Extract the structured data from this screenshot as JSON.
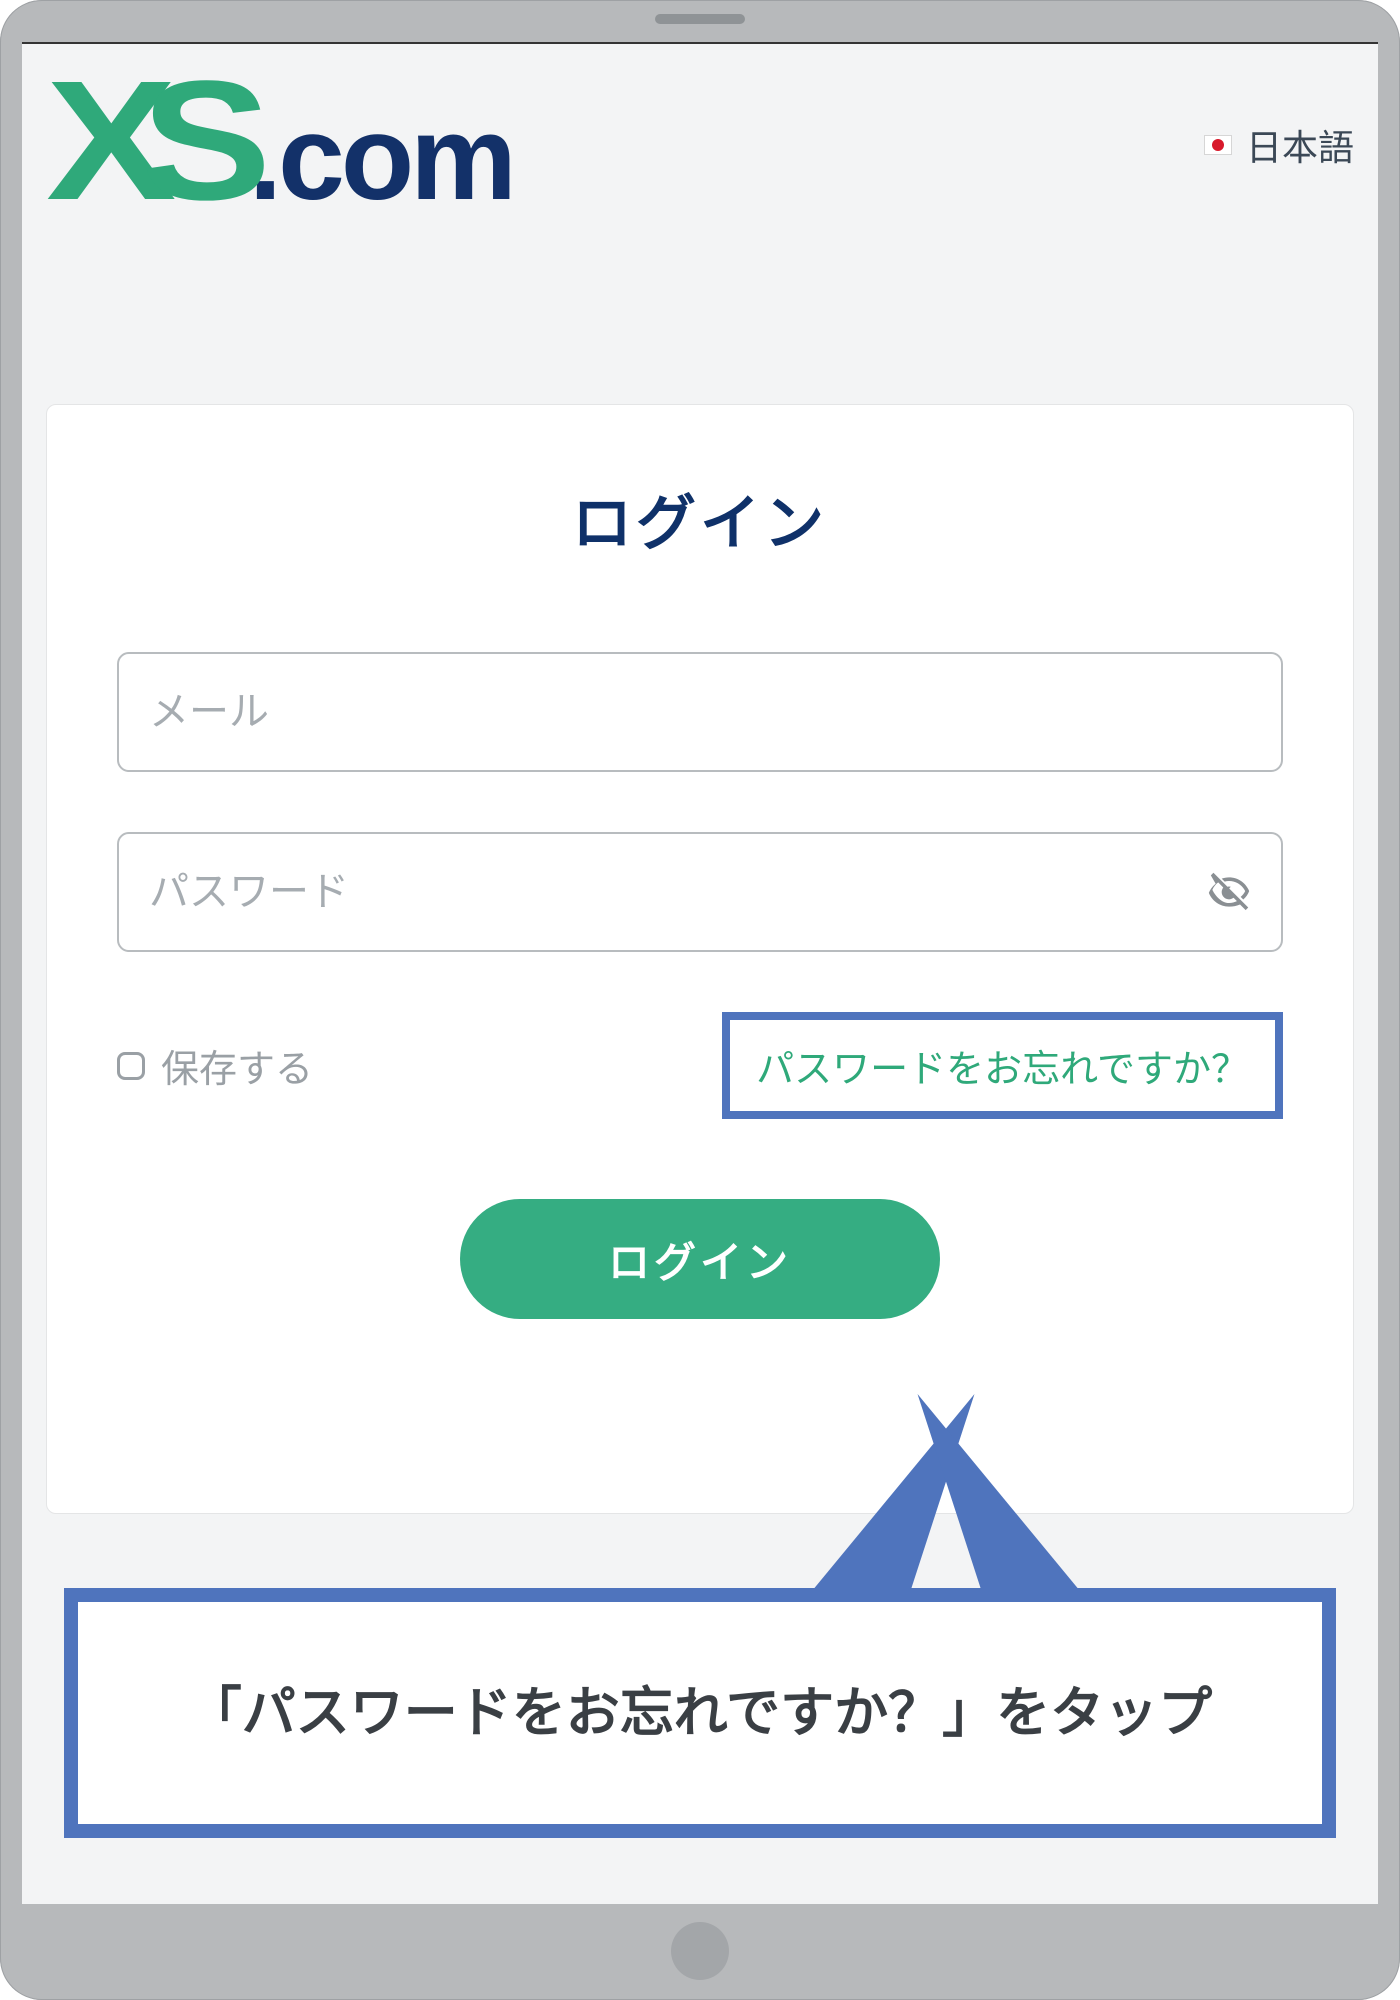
{
  "brand": {
    "xs": "XS",
    "dotcom": ".com"
  },
  "language": {
    "label": "日本語"
  },
  "login": {
    "title": "ログイン",
    "email_placeholder": "メール",
    "password_placeholder": "パスワード",
    "save_label": "保存する",
    "forgot_label": "パスワードをお忘れですか？",
    "button_label": "ログイン"
  },
  "callout": {
    "text": "「パスワードをお忘れですか？」をタップ"
  },
  "colors": {
    "brand_green": "#2fa97a",
    "brand_navy": "#133169",
    "accent_blue": "#4f74bd",
    "button_green": "#35ad82"
  }
}
